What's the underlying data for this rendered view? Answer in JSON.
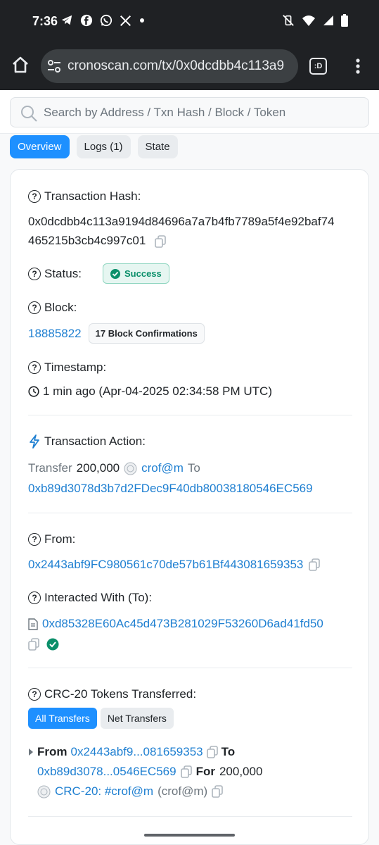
{
  "status_bar": {
    "time": "7:36"
  },
  "browser": {
    "url": "cronoscan.com/tx/0x0dcdbb4c113a9",
    "tab_label": ":D"
  },
  "search": {
    "placeholder": "Search by Address / Txn Hash / Block / Token"
  },
  "tabs": [
    {
      "label": "Overview"
    },
    {
      "label": "Logs (1)"
    },
    {
      "label": "State"
    }
  ],
  "tx": {
    "hash_label": "Transaction Hash:",
    "hash_line1": "0x0dcdbb4c113a9194d84696a7a7b4fb7789a5f4e92baf74",
    "hash_line2": "465215b3cb4c997c01",
    "status_label": "Status:",
    "status_value": "Success",
    "block_label": "Block:",
    "block_number": "18885822",
    "block_confirmations": "17 Block Confirmations",
    "timestamp_label": "Timestamp:",
    "timestamp_value": "1 min ago (Apr-04-2025 02:34:58 PM UTC)",
    "action_label": "Transaction Action:",
    "action_transfer": "Transfer",
    "action_amount": "200,000",
    "action_token": "crof@m",
    "action_to": "To",
    "action_to_address": "0xb89d3078d3b7d2FDec9F40db80038180546EC569",
    "from_label": "From:",
    "from_address": "0x2443abf9FC980561c70de57b61Bf443081659353",
    "interacted_label": "Interacted With (To):",
    "interacted_address": "0xd85328E60Ac45d473B281029F53260D6ad41fd50",
    "tokens_label": "CRC-20 Tokens Transferred:",
    "filter_all": "All Transfers",
    "filter_net": "Net Transfers",
    "transfer_from_word": "From",
    "transfer_from": "0x2443abf9...081659353",
    "transfer_to_word": "To",
    "transfer_to": "0xb89d3078...0546EC569",
    "transfer_for_word": "For",
    "transfer_amount": "200,000",
    "token_link": "CRC-20: #crof@m",
    "token_symbol": "(crof@m)"
  },
  "colors": {
    "accent": "#1e90ff",
    "link": "#1e7fd1",
    "success": "#0b8f6a",
    "dark_bar": "#1f2124"
  }
}
